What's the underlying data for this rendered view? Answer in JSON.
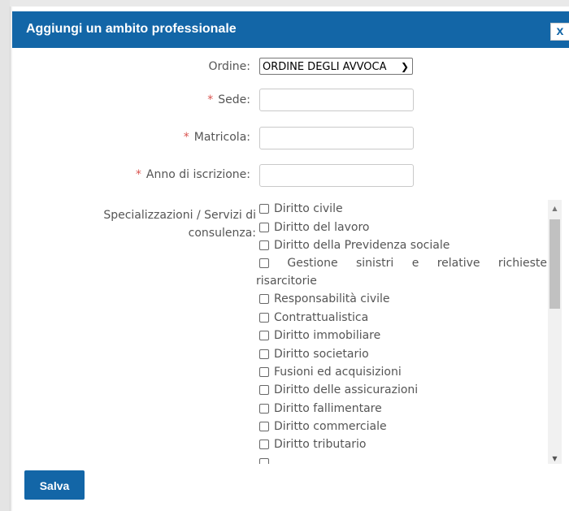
{
  "dialog": {
    "title": "Aggiungi un ambito professionale",
    "close_label": "x",
    "save_label": "Salva"
  },
  "form": {
    "ordine": {
      "label": "Ordine:",
      "value": "ORDINE DEGLI AVVOCA"
    },
    "sede": {
      "label": "Sede:",
      "required_mark": "*",
      "value": ""
    },
    "matricola": {
      "label": "Matricola:",
      "required_mark": "*",
      "value": ""
    },
    "anno": {
      "label": "Anno di iscrizione:",
      "required_mark": "*",
      "value": ""
    },
    "specializzazioni": {
      "label_line1": "Specializzazioni / Servizi di",
      "label_line2": "consulenza:",
      "items": [
        "Diritto civile",
        "Diritto del lavoro",
        "Diritto della Previdenza sociale",
        "Gestione sinistri e relative richieste risarcitorie",
        "Responsabilità civile",
        "Contrattualistica",
        "Diritto immobiliare",
        "Diritto societario",
        "Fusioni ed acquisizioni",
        "Diritto delle assicurazioni",
        "Diritto fallimentare",
        "Diritto commerciale",
        "Diritto tributario"
      ],
      "gestione_words": [
        "Gestione",
        "sinistri",
        "e",
        "relative",
        "richieste"
      ],
      "gestione_wrap": "risarcitorie"
    }
  },
  "colors": {
    "accent": "#1366a7",
    "required": "#d9534f"
  }
}
